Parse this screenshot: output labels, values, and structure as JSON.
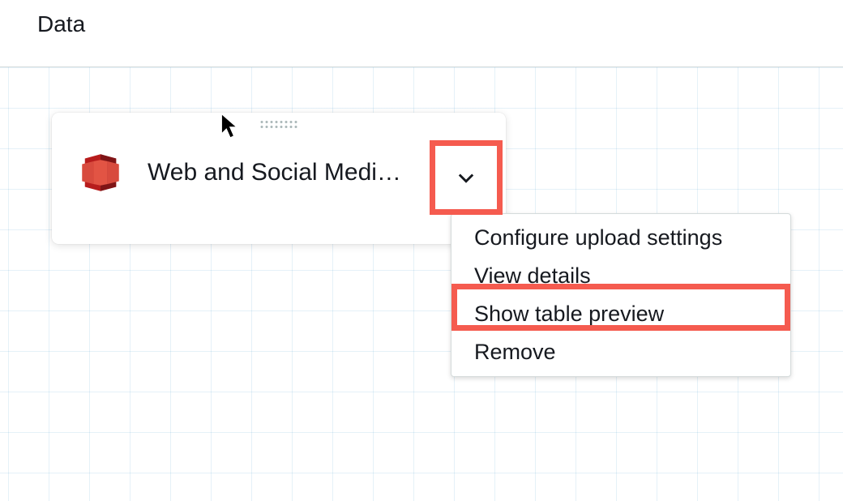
{
  "topbar": {
    "title": "Data"
  },
  "node": {
    "title": "Web and Social Medi…",
    "icon_name": "aws-s3"
  },
  "menu": {
    "items": [
      "Configure upload settings",
      "View details",
      "Show table preview",
      "Remove"
    ]
  },
  "highlight": {
    "color": "#f55b4f"
  }
}
